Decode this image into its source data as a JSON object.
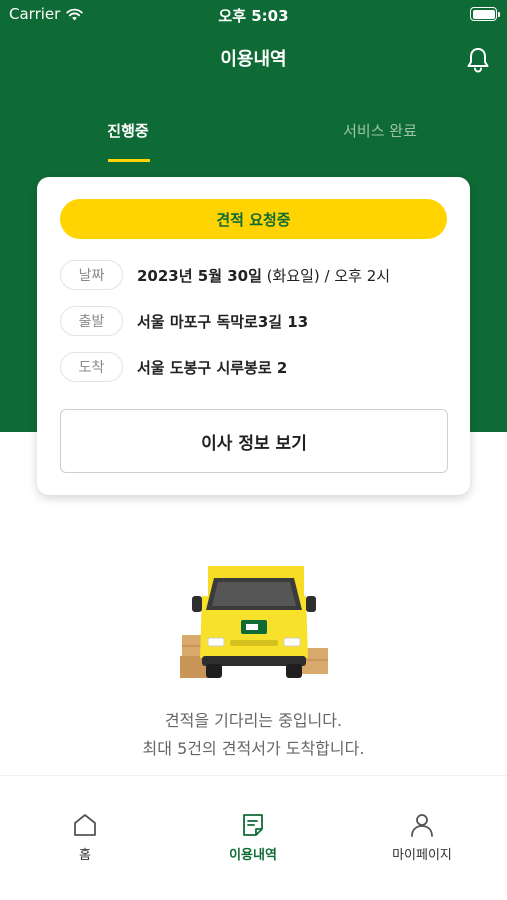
{
  "status_bar": {
    "carrier": "Carrier",
    "time": "오후 5:03"
  },
  "header": {
    "title": "이용내역",
    "bell_icon": "bell-icon"
  },
  "tabs": [
    {
      "label": "진행중",
      "active": true
    },
    {
      "label": "서비스 완료",
      "active": false
    }
  ],
  "card": {
    "status": "견적 요청중",
    "rows": [
      {
        "label": "날짜",
        "value": "2023년 5월 30일",
        "value_extra": " (화요일) / 오후 2시"
      },
      {
        "label": "출발",
        "value": "서울 마포구 독막로3길 13"
      },
      {
        "label": "도착",
        "value": "서울 도봉구 시루봉로 2"
      }
    ],
    "button_label": "이사 정보 보기"
  },
  "message": {
    "line1": "견적을 기다리는 중입니다.",
    "line2": "최대 5건의 견적서가 도착합니다."
  },
  "bottom_nav": [
    {
      "label": "홈",
      "icon": "home-icon",
      "active": false
    },
    {
      "label": "이용내역",
      "icon": "document-icon",
      "active": true
    },
    {
      "label": "마이페이지",
      "icon": "person-icon",
      "active": false
    }
  ],
  "colors": {
    "primary_green": "#0f6b35",
    "accent_yellow": "#ffd400"
  }
}
